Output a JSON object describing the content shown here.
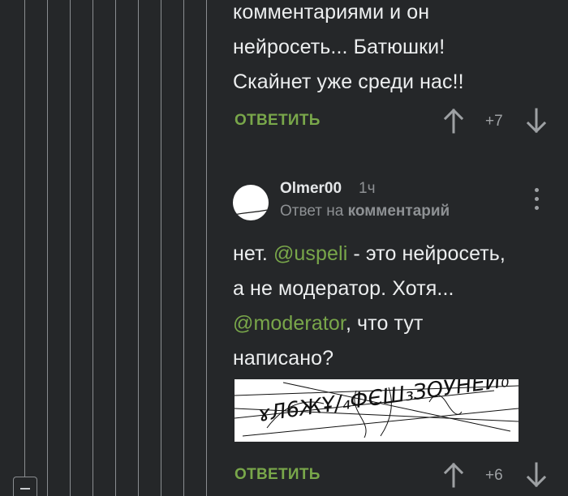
{
  "prev_comment": {
    "lines": [
      "комментариями и он",
      "нейросеть... Батюшки!",
      "Скайнет уже среди нас!!"
    ],
    "reply_label": "ОТВЕТИТЬ",
    "rating": "+7"
  },
  "comment": {
    "username": "Olmer00",
    "time_ago": "1ч",
    "reply_prefix": "Ответ на",
    "reply_target": "комментарий",
    "body": {
      "l1_start": "нет. ",
      "mention1": "@uspeli",
      "l1_end": " - это нейросеть,",
      "l2": "а не модератор. Хотя...",
      "mention2": "@moderator",
      "l3_end": ", что тут",
      "l4": "написано?"
    },
    "captcha_text": "ɤЛ6ЖҰ/₄ФЄШ₃ЗОУНЕИ₀",
    "reply_label": "ОТВЕТИТЬ",
    "rating": "+6"
  },
  "icons": {
    "upvote": "arrow-up-icon",
    "downvote": "arrow-down-icon",
    "more": "more-vertical-icon",
    "collapse": "minus-icon"
  },
  "colors": {
    "background": "#252729",
    "accent_green": "#79a74a",
    "muted_text": "#8e9194",
    "thread_line": "#8a8d90"
  }
}
